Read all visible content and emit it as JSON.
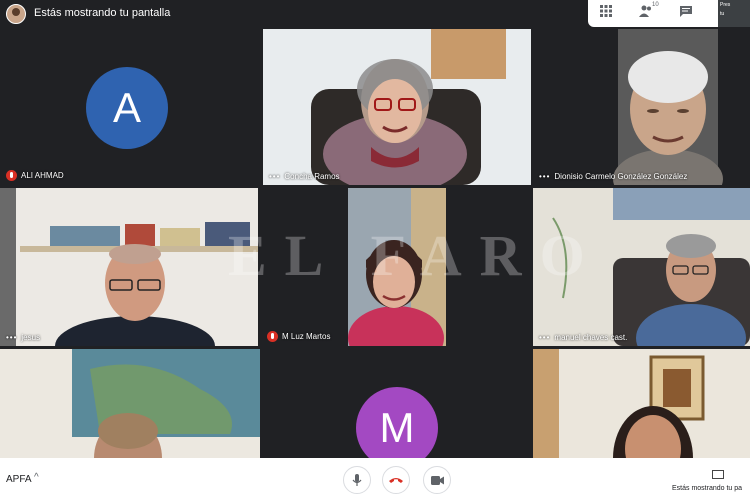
{
  "header": {
    "share_status": "Estás mostrando tu pantalla",
    "participants_badge": "10",
    "corner_text_1": "Pres",
    "corner_text_2": "tu"
  },
  "participants": [
    {
      "name": "ALI AHMAD",
      "initial": "A",
      "avatar_color": "#2f63b0",
      "muted": true
    },
    {
      "name": "Concha Ramos",
      "muted": false
    },
    {
      "name": "Dionisio Carmelo González González",
      "muted": false
    },
    {
      "name": "jesus",
      "muted": false
    },
    {
      "name": "M Luz Martos",
      "muted": true
    },
    {
      "name": "manuel chaves cast.",
      "muted": false
    },
    {
      "name": "",
      "initial": "M",
      "avatar_color": "#a349c2"
    }
  ],
  "watermark": "EL FARO",
  "bottom": {
    "meeting_code": "APFA",
    "presenting_label": "Estás mostrando tu pa"
  },
  "icons": {
    "self_avatar": "self-avatar-icon",
    "grid": "grid-icon",
    "people": "people-icon",
    "chat": "chat-icon",
    "mic": "microphone-icon",
    "end_call": "hang-up-icon",
    "camera": "camera-icon"
  },
  "colors": {
    "end_call": "#d93025",
    "bar_bg": "#202124"
  }
}
